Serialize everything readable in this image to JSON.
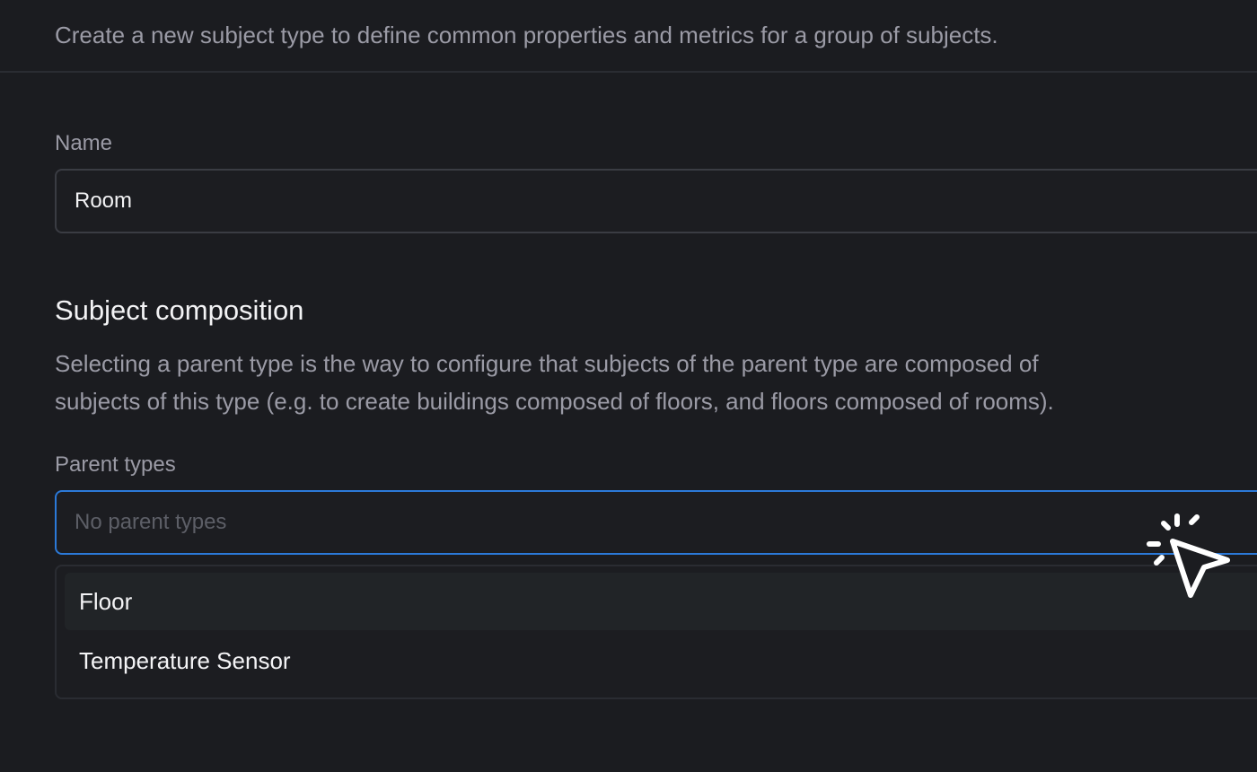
{
  "intro_text": "Create a new subject type to define common properties and metrics for a group of subjects.",
  "name_field": {
    "label": "Name",
    "value": "Room"
  },
  "composition": {
    "title": "Subject composition",
    "description_line1": "Selecting a parent type is the way to configure that subjects of the parent type are composed of",
    "description_line2": "subjects of this type (e.g. to create buildings composed of floors, and floors composed of rooms)."
  },
  "parent_types": {
    "label": "Parent types",
    "placeholder": "No parent types",
    "value": "",
    "options": [
      {
        "label": "Floor",
        "highlighted": true
      },
      {
        "label": "Temperature Sensor",
        "highlighted": false
      }
    ]
  },
  "colors": {
    "background": "#1b1c20",
    "focus_border": "#2b79d8",
    "muted_text": "#9b9ba6"
  },
  "icons": {
    "cursor": "click-cursor-icon"
  }
}
